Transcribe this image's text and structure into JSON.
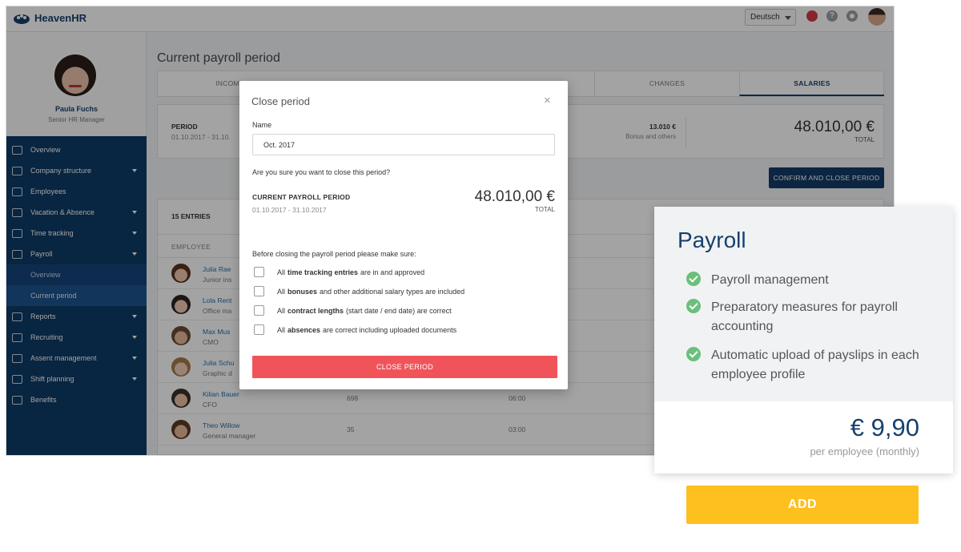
{
  "app": {
    "brand": "HeavenHR",
    "language": "Deutsch",
    "icons": [
      "heart-icon",
      "help-icon",
      "gear-icon",
      "user-avatar"
    ]
  },
  "sidebar": {
    "profile": {
      "name": "Paula Fuchs",
      "role": "Senior HR Manager"
    },
    "items": [
      {
        "label": "Overview",
        "icon": "grid-icon",
        "expandable": false
      },
      {
        "label": "Company structure",
        "icon": "org-chart-icon",
        "expandable": true
      },
      {
        "label": "Employees",
        "icon": "people-icon",
        "expandable": false
      },
      {
        "label": "Vacation & Absence",
        "icon": "umbrella-icon",
        "expandable": true
      },
      {
        "label": "Time tracking",
        "icon": "stopwatch-icon",
        "expandable": true
      },
      {
        "label": "Payroll",
        "icon": "wallet-icon",
        "expandable": true
      },
      {
        "label": "Reports",
        "icon": "pie-chart-icon",
        "expandable": true
      },
      {
        "label": "Recruiting",
        "icon": "recruiting-icon",
        "expandable": true
      },
      {
        "label": "Assent management",
        "icon": "monitor-icon",
        "expandable": true
      },
      {
        "label": "Shift planning",
        "icon": "calendar-icon",
        "expandable": true
      },
      {
        "label": "Benefits",
        "icon": "shield-icon",
        "expandable": false
      }
    ],
    "payroll_sub": [
      "Overview",
      "Current period"
    ]
  },
  "main": {
    "title": "Current payroll period",
    "tabs": {
      "income": "INCOME",
      "changes": "CHANGES",
      "salaries": "SALARIES"
    },
    "summary": {
      "period_label": "PERIOD",
      "period_dates": "01.10.2017 - 31.10.",
      "bonus_value": "13.010 €",
      "bonus_label": "Bonus and others",
      "total_value": "48.010,00 €",
      "total_label": "TOTAL"
    },
    "confirm_button": "CONFIRM AND CLOSE PERIOD",
    "entries_title": "15 ENTRIES",
    "employee_header": "EMPLOYEE",
    "rows": [
      {
        "name": "Julia Rae",
        "role": "Junior ins",
        "c1": "",
        "c2": ""
      },
      {
        "name": "Lola Rent",
        "role": "Office ma",
        "c1": "",
        "c2": ""
      },
      {
        "name": "Max Mus",
        "role": "CMO",
        "c1": "",
        "c2": ""
      },
      {
        "name": "Julia Schu",
        "role": "Graphic d",
        "c1": "",
        "c2": ""
      },
      {
        "name": "Kilian Bauer",
        "role": "CFO",
        "c1": "698",
        "c2": "06:00"
      },
      {
        "name": "Theo Willow",
        "role": "General manager",
        "c1": "35",
        "c2": "03:00"
      }
    ]
  },
  "modal": {
    "title": "Close period",
    "name_label": "Name",
    "name_value": "Oct. 2017",
    "question": "Are you sure you want to close this period?",
    "current_label": "CURRENT PAYROLL PERIOD",
    "current_dates": "01.10.2017 -  31.10.2017",
    "total": "48.010,00 €",
    "total_label": "TOTAL",
    "before_text": "Before closing the payroll period please make sure:",
    "checks": [
      {
        "pre": "All",
        "bold": "time tracking entries",
        "post": "are in and approved"
      },
      {
        "pre": "All",
        "bold": "bonuses",
        "post": "and other additional salary types are included"
      },
      {
        "pre": "All",
        "bold": "contract lengths",
        "post": "(start date / end date) are correct"
      },
      {
        "pre": "All",
        "bold": "absences",
        "post": "are correct including uploaded documents"
      }
    ],
    "close_button": "CLOSE PERIOD"
  },
  "pricing": {
    "title": "Payroll",
    "features": [
      "Payroll management",
      "Preparatory measures for payroll accounting",
      "Automatic upload of payslips in each employee profile"
    ],
    "price": "€ 9,90",
    "price_sub": "per employee (monthly)",
    "add_button": "ADD"
  },
  "colors": {
    "brand_navy": "#16416e",
    "close_red": "#f0545a",
    "add_yellow": "#fec01e",
    "check_green": "#6cbf7a"
  }
}
